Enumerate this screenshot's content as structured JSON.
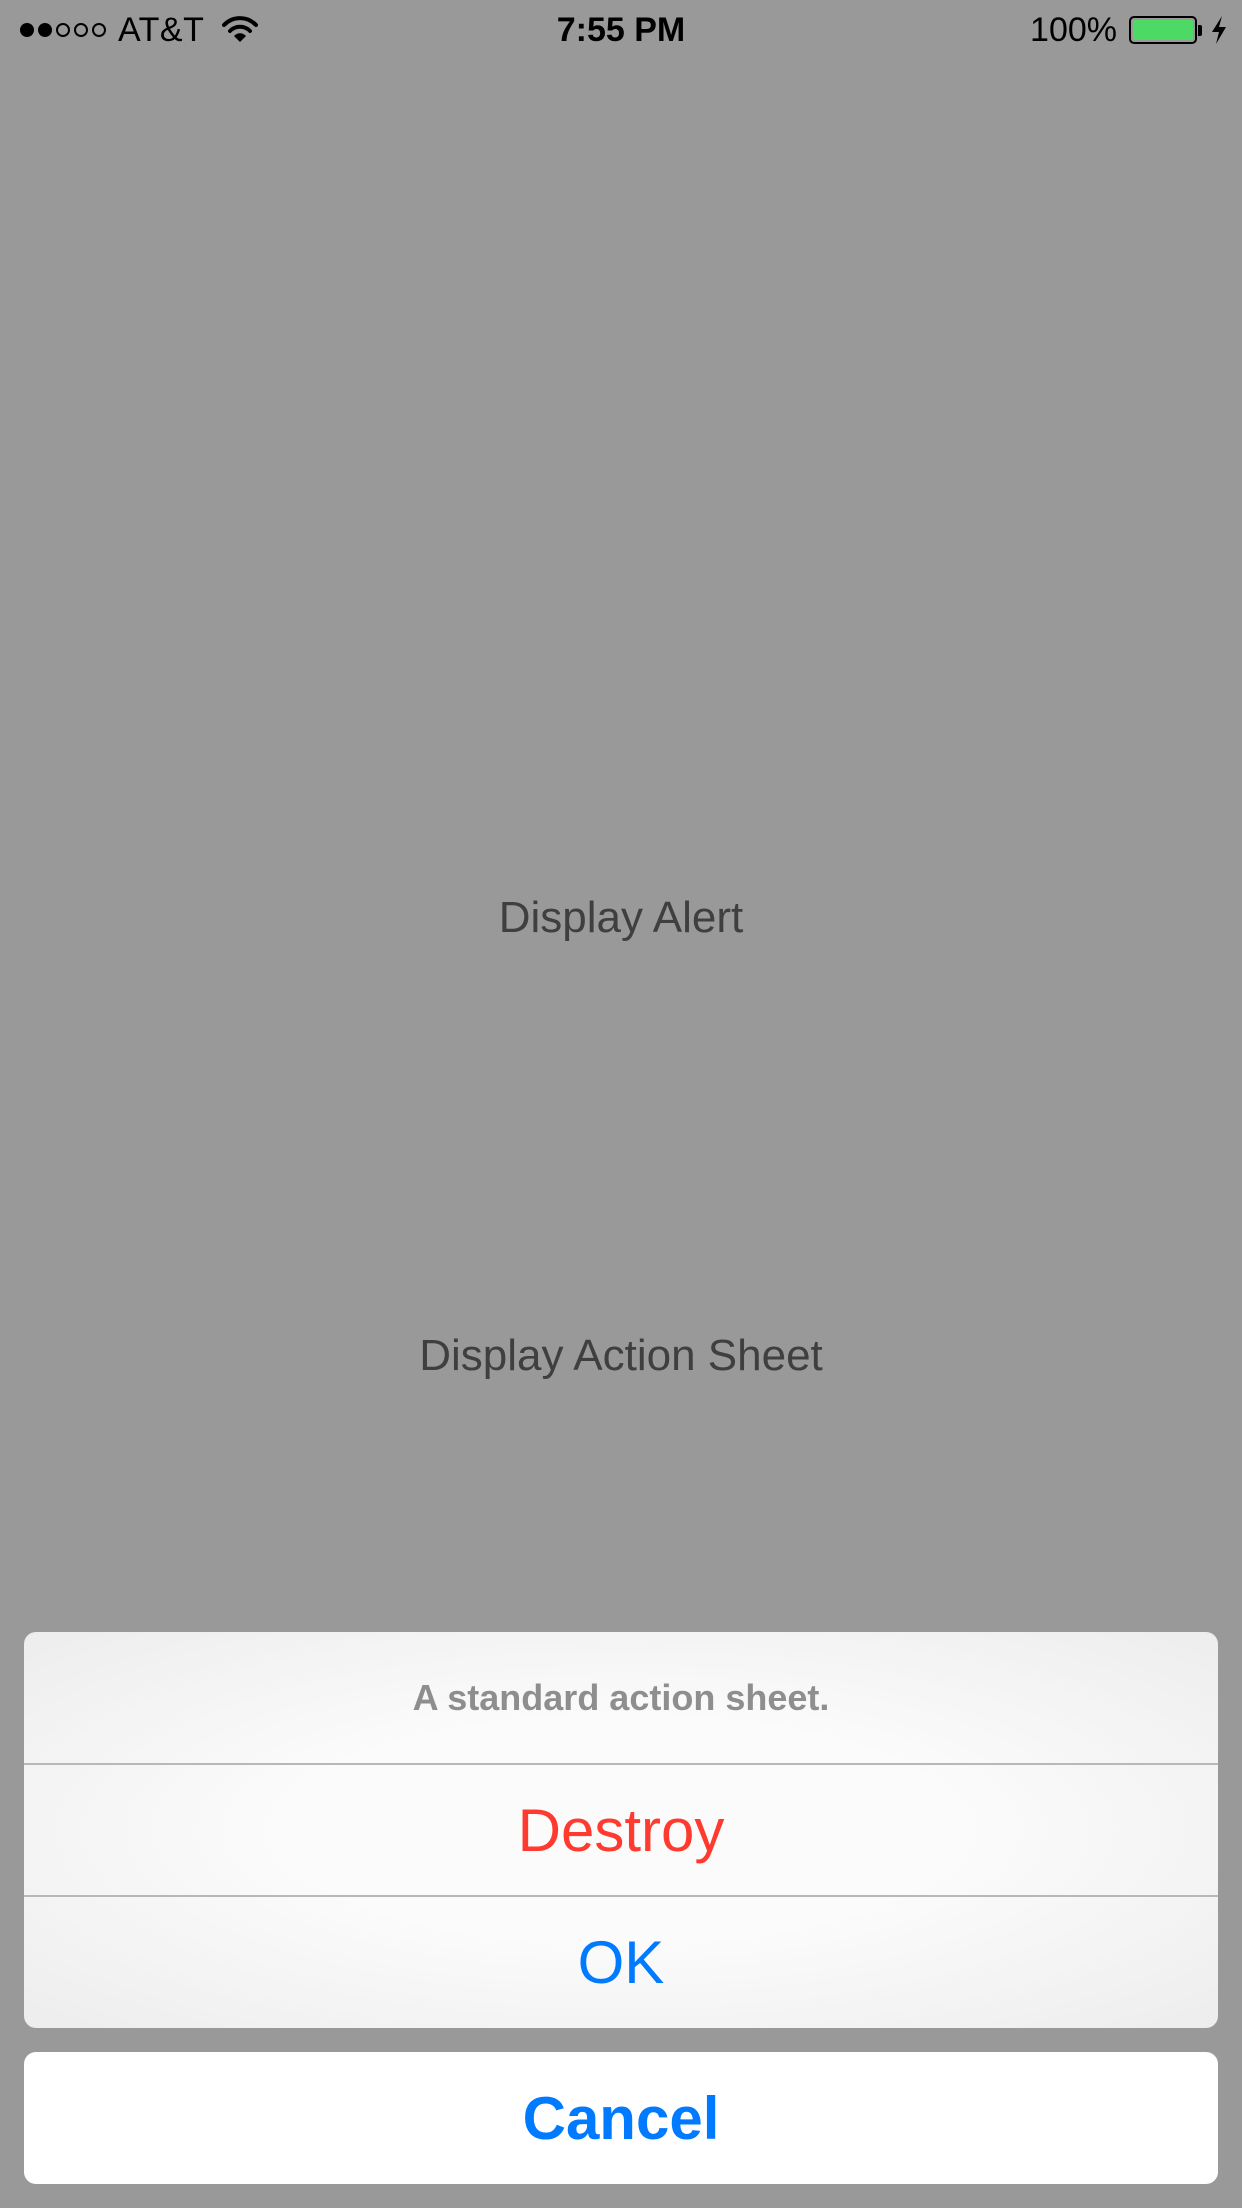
{
  "status_bar": {
    "carrier": "AT&T",
    "signal_bars_filled": 2,
    "signal_bars_total": 5,
    "time": "7:55 PM",
    "battery_percent": "100%",
    "battery_level": 1.0,
    "charging": true,
    "icons": [
      "signal-dots-icon",
      "wifi-icon",
      "battery-icon",
      "charging-bolt-icon"
    ]
  },
  "main": {
    "display_alert_label": "Display Alert",
    "display_action_sheet_label": "Display Action Sheet"
  },
  "action_sheet": {
    "title": "A standard action sheet.",
    "destructive_label": "Destroy",
    "ok_label": "OK",
    "cancel_label": "Cancel"
  },
  "colors": {
    "dimmed_background": "#999999",
    "destructive": "#ff3b30",
    "tint": "#007aff",
    "battery_fill": "#4cd964"
  }
}
